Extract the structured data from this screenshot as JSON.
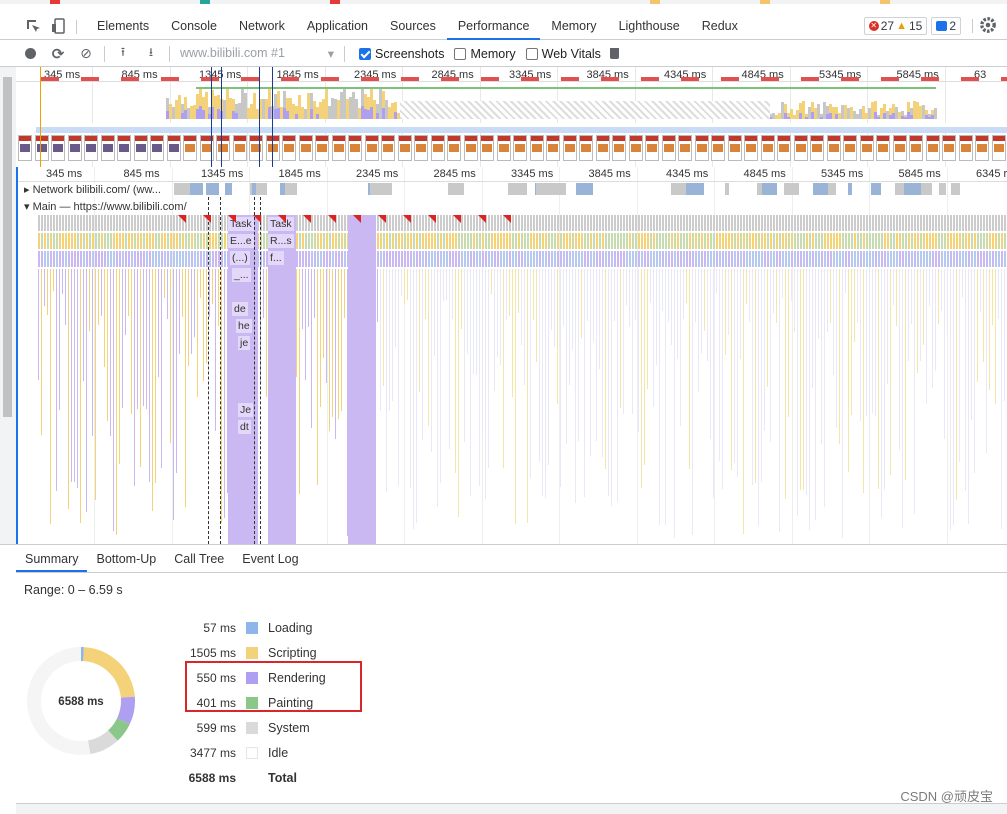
{
  "devtools": {
    "tabs": [
      "Elements",
      "Console",
      "Network",
      "Application",
      "Sources",
      "Performance",
      "Memory",
      "Lighthouse",
      "Redux"
    ],
    "active_tab": "Performance",
    "errors": "27",
    "warnings": "15",
    "messages": "2"
  },
  "toolbar": {
    "profile_select": "www.bilibili.com #1",
    "screenshots_label": "Screenshots",
    "memory_label": "Memory",
    "web_vitals_label": "Web Vitals"
  },
  "overview": {
    "ticks": [
      "345 ms",
      "845 ms",
      "1345 ms",
      "1845 ms",
      "2345 ms",
      "2845 ms",
      "3345 ms",
      "3845 ms",
      "4345 ms",
      "4845 ms",
      "5345 ms",
      "5845 ms",
      "63"
    ]
  },
  "flame": {
    "ticks": [
      "345 ms",
      "845 ms",
      "1345 ms",
      "1845 ms",
      "2345 ms",
      "2845 ms",
      "3345 ms",
      "3845 ms",
      "4345 ms",
      "4845 ms",
      "5345 ms",
      "5845 ms",
      "6345 r"
    ],
    "network_label": "Network",
    "network_url": "bilibili.com/ (ww...",
    "main_label": "Main — https://www.bilibili.com/",
    "task_labels": [
      "Task",
      "Task",
      "E...e",
      "R...s",
      "(...)",
      "f...",
      "_...",
      "de",
      "he",
      "je",
      "Je",
      "dt"
    ]
  },
  "summary": {
    "tabs": [
      "Summary",
      "Bottom-Up",
      "Call Tree",
      "Event Log"
    ],
    "active_tab": "Summary",
    "range": "Range: 0 – 6.59 s",
    "total_center": "6588 ms",
    "rows": [
      {
        "value": "57 ms",
        "name": "Loading",
        "color": "#8fb6e8"
      },
      {
        "value": "1505 ms",
        "name": "Scripting",
        "color": "#f3d27a"
      },
      {
        "value": "550 ms",
        "name": "Rendering",
        "color": "#af9ff0"
      },
      {
        "value": "401 ms",
        "name": "Painting",
        "color": "#8cc78a"
      },
      {
        "value": "599 ms",
        "name": "System",
        "color": "#dadada"
      },
      {
        "value": "3477 ms",
        "name": "Idle",
        "color": "#ffffff"
      },
      {
        "value": "6588 ms",
        "name": "Total",
        "color": ""
      }
    ]
  },
  "watermark": "CSDN @顽皮宝"
}
